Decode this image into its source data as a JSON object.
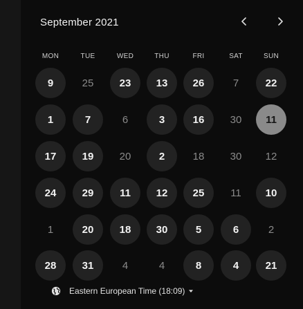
{
  "calendar": {
    "month_label": "September 2021",
    "weekdays": [
      "MON",
      "TUE",
      "WED",
      "THU",
      "FRI",
      "SAT",
      "SUN"
    ],
    "rows": [
      [
        {
          "d": "9",
          "s": "avail"
        },
        {
          "d": "25",
          "s": "unavail"
        },
        {
          "d": "23",
          "s": "avail"
        },
        {
          "d": "13",
          "s": "avail"
        },
        {
          "d": "26",
          "s": "avail"
        },
        {
          "d": "7",
          "s": "unavail"
        },
        {
          "d": "22",
          "s": "avail"
        }
      ],
      [
        {
          "d": "1",
          "s": "avail"
        },
        {
          "d": "7",
          "s": "avail"
        },
        {
          "d": "6",
          "s": "unavail"
        },
        {
          "d": "3",
          "s": "avail"
        },
        {
          "d": "16",
          "s": "avail"
        },
        {
          "d": "30",
          "s": "unavail"
        },
        {
          "d": "11",
          "s": "selected"
        }
      ],
      [
        {
          "d": "17",
          "s": "avail"
        },
        {
          "d": "19",
          "s": "avail"
        },
        {
          "d": "20",
          "s": "unavail"
        },
        {
          "d": "2",
          "s": "avail"
        },
        {
          "d": "18",
          "s": "unavail"
        },
        {
          "d": "30",
          "s": "unavail"
        },
        {
          "d": "12",
          "s": "unavail"
        }
      ],
      [
        {
          "d": "24",
          "s": "avail"
        },
        {
          "d": "29",
          "s": "avail"
        },
        {
          "d": "11",
          "s": "avail"
        },
        {
          "d": "12",
          "s": "avail"
        },
        {
          "d": "25",
          "s": "avail"
        },
        {
          "d": "11",
          "s": "unavail"
        },
        {
          "d": "10",
          "s": "avail"
        }
      ],
      [
        {
          "d": "1",
          "s": "unavail"
        },
        {
          "d": "20",
          "s": "avail"
        },
        {
          "d": "18",
          "s": "avail"
        },
        {
          "d": "30",
          "s": "avail"
        },
        {
          "d": "5",
          "s": "avail"
        },
        {
          "d": "6",
          "s": "avail"
        },
        {
          "d": "2",
          "s": "unavail"
        }
      ],
      [
        {
          "d": "28",
          "s": "avail"
        },
        {
          "d": "31",
          "s": "avail"
        },
        {
          "d": "4",
          "s": "unavail"
        },
        {
          "d": "4",
          "s": "unavail"
        },
        {
          "d": "8",
          "s": "avail"
        },
        {
          "d": "4",
          "s": "avail"
        },
        {
          "d": "21",
          "s": "avail"
        }
      ]
    ]
  },
  "timezone": {
    "label": "Eastern European Time (18:09)",
    "icon": "globe-icon"
  },
  "icons": {
    "prev": "chevron-left-icon",
    "next": "chevron-right-icon",
    "dropdown": "caret-down-icon"
  },
  "colors": {
    "background": "#0c0c0c",
    "available_day_bg": "#222222",
    "selected_day_bg": "#8a8a8a",
    "unavailable_text": "#8a8a8a"
  }
}
